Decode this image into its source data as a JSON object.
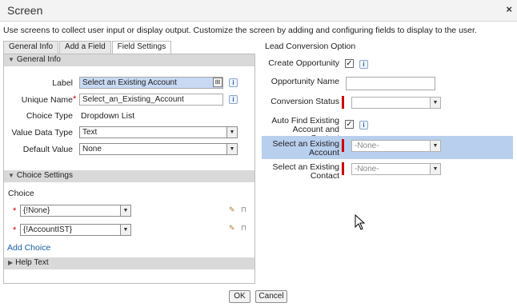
{
  "dialog": {
    "title": "Screen",
    "close_label": "×"
  },
  "description": "Use screens to collect user input or display output. Customize the screen by adding and configuring fields to display to the user.",
  "tabs": [
    {
      "label": "General Info"
    },
    {
      "label": "Add a Field"
    },
    {
      "label": "Field Settings"
    }
  ],
  "general_info": {
    "header": "General Info",
    "label_label": "Label",
    "label_value": "Select an Existing Account",
    "unique_name_label": "Unique Name",
    "unique_name_value": "Select_an_Existing_Account",
    "choice_type_label": "Choice Type",
    "choice_type_value": "Dropdown List",
    "value_data_type_label": "Value Data Type",
    "value_data_type_value": "Text",
    "default_value_label": "Default Value",
    "default_value_value": "None"
  },
  "choice_settings": {
    "header": "Choice Settings",
    "choice_label": "Choice",
    "choices": [
      {
        "value": "{!None}"
      },
      {
        "value": "{!AccountIST}"
      }
    ],
    "add_choice": "Add Choice"
  },
  "help_text": {
    "header": "Help Text"
  },
  "lead_conversion": {
    "header": "Lead Conversion Option",
    "create_opportunity_label": "Create Opportunity",
    "create_opportunity_checked": "✓",
    "opportunity_name_label": "Opportunity Name",
    "opportunity_name_value": "",
    "conversion_status_label": "Conversion Status",
    "conversion_status_value": "",
    "auto_find_label_1": "Auto Find Existing",
    "auto_find_label_2": "Account and Contact",
    "auto_find_checked": "✓",
    "existing_account_label_1": "Select an Existing",
    "existing_account_label_2": "Account",
    "existing_account_value": "-None-",
    "existing_contact_label_1": "Select an Existing",
    "existing_contact_label_2": "Contact",
    "existing_contact_value": "-None-"
  },
  "buttons": {
    "ok": "OK",
    "cancel": "Cancel"
  },
  "icons": {
    "info": "info-icon",
    "dropdown": "chevron-down-icon",
    "edit": "pencil-icon",
    "delete": "trash-icon",
    "collapse": "triangle-down-icon",
    "expand": "triangle-right-icon",
    "resource_picker": "resource-picker-icon",
    "cursor": "mouse-pointer-icon"
  },
  "colors": {
    "accent_highlight": "#b9cfee",
    "required": "#cc0000",
    "link": "#1a5ea8",
    "section_header": "#d9d9d9"
  }
}
